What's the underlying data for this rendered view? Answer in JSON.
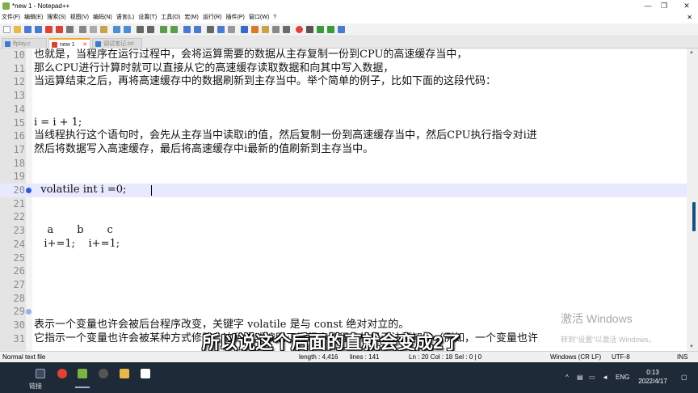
{
  "window": {
    "title": "*new 1 - Notepad++",
    "controls": [
      "—",
      "❐",
      "✕"
    ]
  },
  "menubar": {
    "items": [
      "文件(F)",
      "编辑(E)",
      "搜索(S)",
      "视图(V)",
      "编码(N)",
      "语言(L)",
      "设置(T)",
      "工具(O)",
      "宏(M)",
      "运行(R)",
      "插件(P)",
      "窗口(W)",
      "?"
    ],
    "right_glyph": "✕"
  },
  "tabs": [
    {
      "label": "ffplay.c",
      "active": false,
      "icon_color": "#3a7bd5"
    },
    {
      "label": "new 1",
      "active": true,
      "icon_color": "#d9443a"
    },
    {
      "label": "调试笔记.txt",
      "active": false,
      "icon_color": "#3a7bd5"
    }
  ],
  "editor": {
    "lines": [
      {
        "num": "10",
        "text": "也就是，当程序在运行过程中，会将运算需要的数据从主存复制一份到CPU的高速缓存当中，"
      },
      {
        "num": "11",
        "text": "那么CPU进行计算时就可以直接从它的高速缓存读取数据和向其中写入数据，"
      },
      {
        "num": "12",
        "text": "当运算结束之后，再将高速缓存中的数据刷新到主存当中。举个简单的例子，比如下面的这段代码："
      },
      {
        "num": "13",
        "text": ""
      },
      {
        "num": "14",
        "text": ""
      },
      {
        "num": "15",
        "text": "i = i + 1;"
      },
      {
        "num": "16",
        "text": "当线程执行这个语句时，会先从主存当中读取i的值，然后复制一份到高速缓存当中，然后CPU执行指令对i进"
      },
      {
        "num": "17",
        "text": "然后将数据写入高速缓存，最后将高速缓存中i最新的值刷新到主存当中。"
      },
      {
        "num": "18",
        "text": ""
      },
      {
        "num": "19",
        "text": ""
      },
      {
        "num": "20",
        "text": "  volatile int i =0;"
      },
      {
        "num": "21",
        "text": ""
      },
      {
        "num": "22",
        "text": ""
      },
      {
        "num": "23",
        "text": "    a       b       c"
      },
      {
        "num": "24",
        "text": "   i+=1;    i+=1;"
      },
      {
        "num": "25",
        "text": ""
      },
      {
        "num": "26",
        "text": ""
      },
      {
        "num": "27",
        "text": ""
      },
      {
        "num": "28",
        "text": ""
      },
      {
        "num": "29",
        "text": ""
      },
      {
        "num": "30",
        "text": "表示一个变量也许会被后台程序改变，关键字 volatile 是与 const 绝对对立的。"
      },
      {
        "num": "31",
        "text": "它指示一个变量也许会被某种方式修改，这种方式按照正常程序流程分析是无法预知的（例如，一个变量也许"
      }
    ]
  },
  "overlay": {
    "watermark_title": "激活 Windows",
    "watermark_sub": "转到\"设置\"以激活 Windows。",
    "subtitle": "所以说这个后面的直就会变成2了"
  },
  "statusbar": {
    "file_type": "Normal text file",
    "length": "length : 4,416",
    "lines": "lines : 141",
    "position": "Ln : 20   Col : 18   Sel : 0 | 0",
    "eol": "Windows (CR LF)",
    "encoding": "UTF-8",
    "mode": "INS"
  },
  "taskbar": {
    "link_label": "链接",
    "input_method": "ENG",
    "time": "0:13",
    "date": "2022/4/17"
  }
}
